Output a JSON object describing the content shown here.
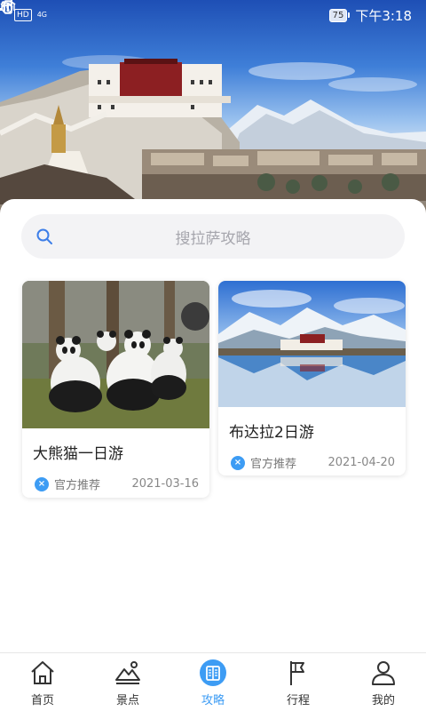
{
  "status_bar": {
    "hd": "HD",
    "network": "4G",
    "battery": "75",
    "time": "下午3:18"
  },
  "search": {
    "placeholder": "搜拉萨攻略"
  },
  "cards": [
    {
      "title": "大熊猫一日游",
      "badge": "官方推荐",
      "date": "2021-03-16",
      "image_icon": "panda-photo"
    },
    {
      "title": "布达拉2日游",
      "badge": "官方推荐",
      "date": "2021-04-20",
      "image_icon": "potala-lake-photo"
    }
  ],
  "nav": {
    "items": [
      {
        "label": "首页",
        "icon": "home-icon"
      },
      {
        "label": "景点",
        "icon": "mountain-icon"
      },
      {
        "label": "攻略",
        "icon": "book-icon",
        "active": true
      },
      {
        "label": "行程",
        "icon": "flag-icon"
      },
      {
        "label": "我的",
        "icon": "user-icon"
      }
    ]
  },
  "colors": {
    "accent": "#3d9cf4",
    "search_bg": "#f3f3f5"
  }
}
